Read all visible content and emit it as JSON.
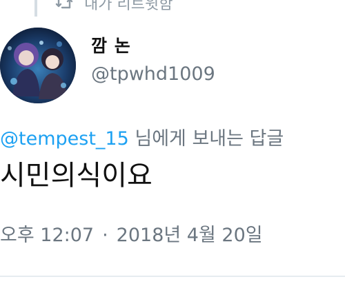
{
  "retweet_header": {
    "label": "내가 리트윗함",
    "icon": "retweet-icon"
  },
  "author": {
    "display_name": "깜 논",
    "handle": "@tpwhd1009",
    "avatar_icon": "avatar"
  },
  "reply": {
    "mention": "@tempest_15",
    "suffix": " 님에게 보내는 답글"
  },
  "tweet": {
    "text": "시민의식이요"
  },
  "timestamp": {
    "time": "오후 12:07",
    "separator": "·",
    "date": "2018년 4월 20일"
  },
  "colors": {
    "link": "#1da1f2",
    "secondary_text": "#6b7680",
    "primary_text": "#111111"
  }
}
